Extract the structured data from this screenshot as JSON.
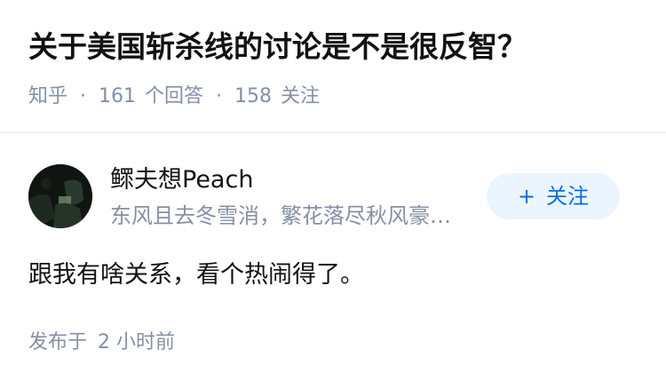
{
  "question": {
    "title": "关于美国斩杀线的讨论是不是很反智？",
    "source": "知乎",
    "separator": "·",
    "answer_count": "161",
    "answer_label": "个回答",
    "follower_count": "158",
    "follower_label": "关注"
  },
  "answer": {
    "author_name": "鳏夫想Peach",
    "author_bio": "东风且去冬雪消，繁花落尽秋风豪…",
    "follow_plus": "+",
    "follow_label": "关注",
    "content": "跟我有啥关系，看个热闹得了。",
    "published_label": "发布于",
    "published_time": "2 小时前"
  },
  "colors": {
    "meta_gray": "#8590a6",
    "follow_blue": "#056de8",
    "follow_bg": "#ebf5ff"
  }
}
